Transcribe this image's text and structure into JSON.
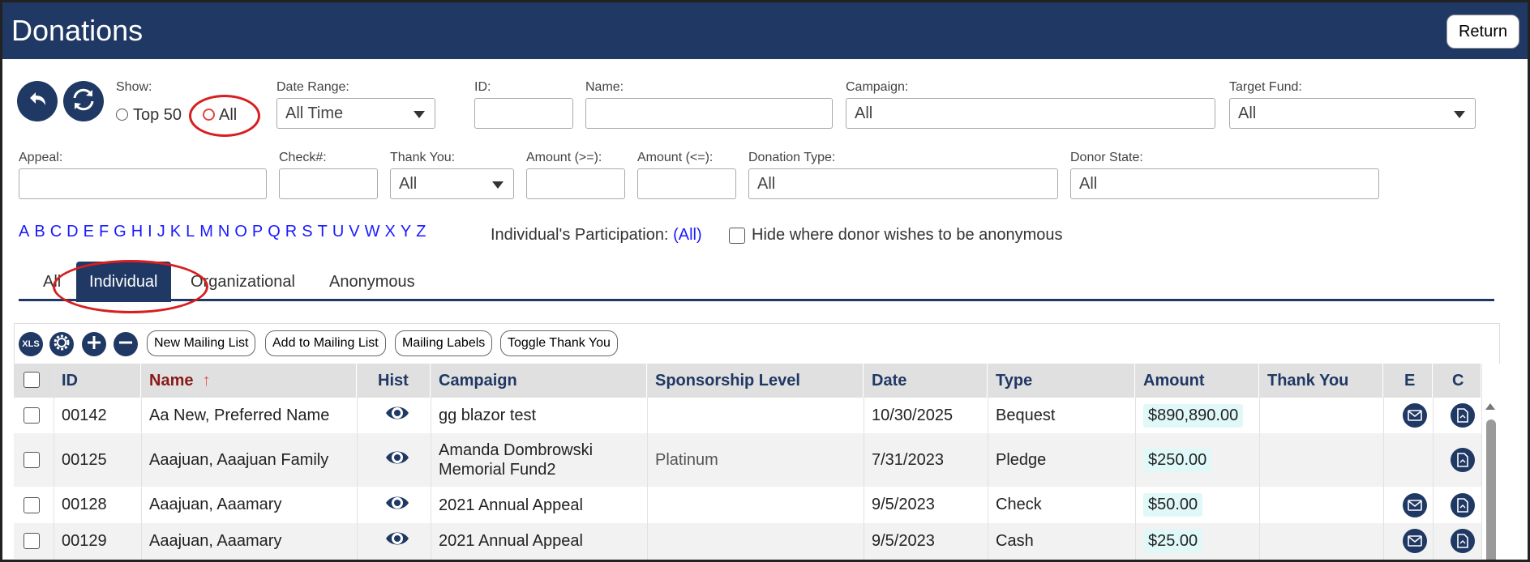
{
  "header": {
    "title": "Donations",
    "return_label": "Return"
  },
  "filters": {
    "show_label": "Show:",
    "show_top50": "Top 50",
    "show_all": "All",
    "date_range_label": "Date Range:",
    "date_range_value": "All Time",
    "id_label": "ID:",
    "name_label": "Name:",
    "campaign_label": "Campaign:",
    "campaign_value": "All",
    "target_fund_label": "Target Fund:",
    "target_fund_value": "All",
    "appeal_label": "Appeal:",
    "check_label": "Check#:",
    "thank_you_label": "Thank You:",
    "thank_you_value": "All",
    "amount_gte_label": "Amount (>=):",
    "amount_lte_label": "Amount (<=):",
    "donation_type_label": "Donation Type:",
    "donation_type_value": "All",
    "donor_state_label": "Donor State:",
    "donor_state_value": "All"
  },
  "alphabet": [
    "A",
    "B",
    "C",
    "D",
    "E",
    "F",
    "G",
    "H",
    "I",
    "J",
    "K",
    "L",
    "M",
    "N",
    "O",
    "P",
    "Q",
    "R",
    "S",
    "T",
    "U",
    "V",
    "W",
    "X",
    "Y",
    "Z"
  ],
  "participation": {
    "label": "Individual's Participation:",
    "value": "(All)"
  },
  "anonymous_checkbox_label": "Hide where donor wishes to be anonymous",
  "tabs": [
    {
      "label": "All",
      "active": false
    },
    {
      "label": "Individual",
      "active": true
    },
    {
      "label": "Organizational",
      "active": false
    },
    {
      "label": "Anonymous",
      "active": false
    }
  ],
  "toolbar": {
    "xls_label": "XLS",
    "new_mailing_list": "New Mailing List",
    "add_to_mailing_list": "Add to Mailing List",
    "mailing_labels": "Mailing Labels",
    "toggle_thank_you": "Toggle Thank You"
  },
  "table": {
    "columns": [
      "ID",
      "Name",
      "Hist",
      "Campaign",
      "Sponsorship Level",
      "Date",
      "Type",
      "Amount",
      "Thank You",
      "E",
      "C"
    ],
    "sort_indicator": "↑",
    "rows": [
      {
        "id": "00142",
        "name": "Aa New, Preferred Name",
        "campaign": "gg blazor test",
        "campaign2": "",
        "sponsorship": "",
        "date": "10/30/2025",
        "type": "Bequest",
        "amount": "$890,890.00",
        "thank_you": "",
        "email": true,
        "contact": true
      },
      {
        "id": "00125",
        "name": "Aaajuan, Aaajuan Family",
        "campaign": "Amanda Dombrowski",
        "campaign2": "Memorial Fund2",
        "sponsorship": "Platinum",
        "date": "7/31/2023",
        "type": "Pledge",
        "amount": "$250.00",
        "thank_you": "",
        "email": false,
        "contact": true
      },
      {
        "id": "00128",
        "name": "Aaajuan, Aaamary",
        "campaign": "2021 Annual Appeal",
        "campaign2": "",
        "sponsorship": "",
        "date": "9/5/2023",
        "type": "Check",
        "amount": "$50.00",
        "thank_you": "",
        "email": true,
        "contact": true
      },
      {
        "id": "00129",
        "name": "Aaajuan, Aaamary",
        "campaign": "2021 Annual Appeal",
        "campaign2": "",
        "sponsorship": "",
        "date": "9/5/2023",
        "type": "Cash",
        "amount": "$25.00",
        "thank_you": "",
        "email": true,
        "contact": true
      }
    ]
  },
  "colors": {
    "header_bg": "#1f3864",
    "link": "#1a1aff",
    "sorted_header": "#8b1a1a",
    "highlight": "#d81e1e",
    "amount_bg": "#e0f8f8"
  }
}
